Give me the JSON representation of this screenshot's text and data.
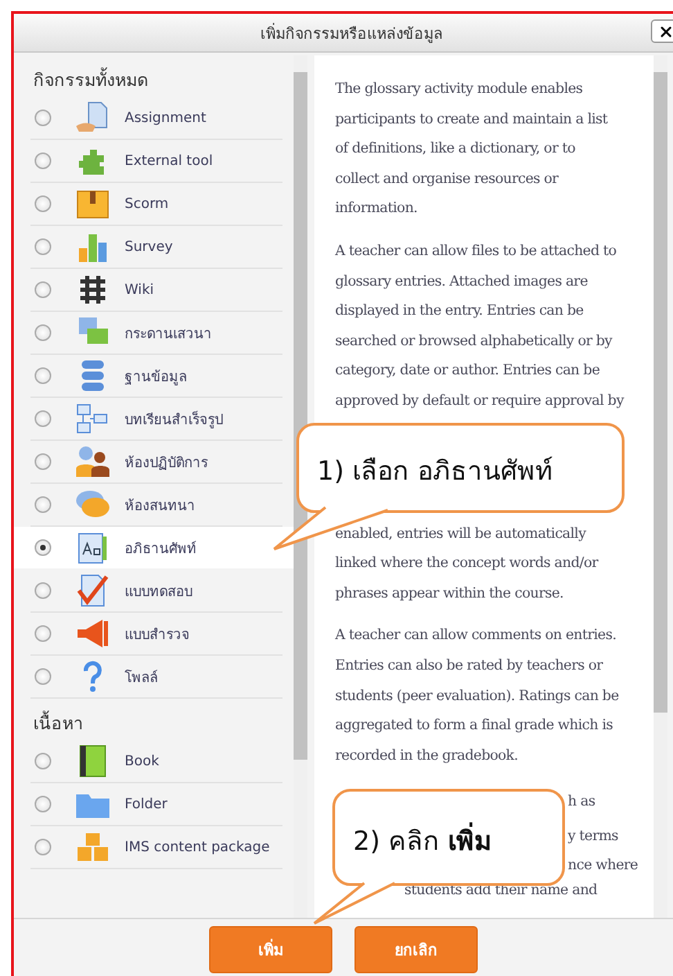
{
  "dialog": {
    "title": "เพิ่มกิจกรรมหรือแหล่งข้อมูล"
  },
  "sections": [
    {
      "heading": "กิจกรรมทั้งหมด",
      "items": [
        {
          "label": "Assignment",
          "selected": false
        },
        {
          "label": "External tool",
          "selected": false
        },
        {
          "label": "Scorm",
          "selected": false
        },
        {
          "label": "Survey",
          "selected": false
        },
        {
          "label": "Wiki",
          "selected": false
        },
        {
          "label": "กระดานเสวนา",
          "selected": false
        },
        {
          "label": "ฐานข้อมูล",
          "selected": false
        },
        {
          "label": "บทเรียนสำเร็จรูป",
          "selected": false
        },
        {
          "label": "ห้องปฏิบัติการ",
          "selected": false
        },
        {
          "label": "ห้องสนทนา",
          "selected": false
        },
        {
          "label": "อภิธานศัพท์",
          "selected": true
        },
        {
          "label": "แบบทดสอบ",
          "selected": false
        },
        {
          "label": "แบบสำรวจ",
          "selected": false
        },
        {
          "label": "โพลล์",
          "selected": false
        }
      ]
    },
    {
      "heading": "เนื้อหา",
      "items": [
        {
          "label": "Book",
          "selected": false
        },
        {
          "label": "Folder",
          "selected": false
        },
        {
          "label": "IMS content package",
          "selected": false
        }
      ]
    }
  ],
  "description": [
    {
      "kind": "paragraph",
      "lines": [
        "The glossary activity module enables",
        "participants to create and maintain a list",
        "of definitions, like a dictionary, or to",
        "collect and organise resources or",
        "information."
      ]
    },
    {
      "kind": "paragraph",
      "lines": [
        "A teacher can allow files to be attached to",
        "glossary entries. Attached images are",
        "displayed in the entry. Entries can be",
        "searched or browsed alphabetically or by",
        "category, date or author. Entries can be",
        "approved by default or require approval by"
      ]
    },
    {
      "kind": "covered"
    },
    {
      "kind": "continued",
      "lines": [
        "enabled, entries will be automatically",
        "linked where the concept words and/or",
        "phrases appear within the course."
      ]
    },
    {
      "kind": "paragraph",
      "lines": [
        "A teacher can allow comments on entries.",
        "Entries can also be rated by teachers or",
        "students (peer evaluation). Ratings can be",
        "aggregated to form a final grade which is",
        "recorded in the gradebook."
      ]
    },
    {
      "kind": "fragment",
      "text": "h as"
    },
    {
      "kind": "fragment",
      "text": "y terms"
    },
    {
      "kind": "fragment",
      "text": "nce where"
    },
    {
      "kind": "tail_fragment",
      "text": "students add their name and"
    }
  ],
  "buttons": [
    {
      "label": "เพิ่ม"
    },
    {
      "label": "ยกเลิก"
    }
  ],
  "callouts": [
    {
      "kind": "upper",
      "text": "1) เลือก อภิธานศัพท์"
    },
    {
      "kind": "lower",
      "text": "2) คลิก **เพิ่ม**"
    }
  ]
}
